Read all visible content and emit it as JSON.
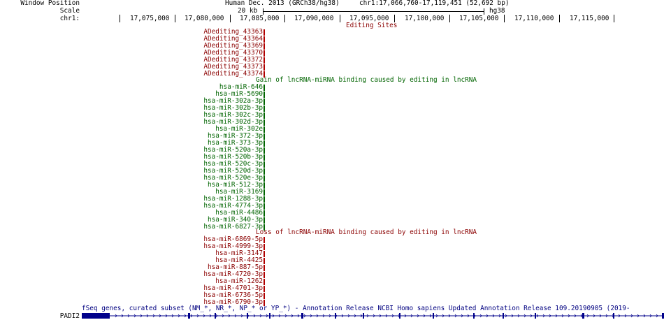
{
  "header": {
    "window_position_label": "Window Position",
    "scale_label": "Scale",
    "chrom_label": "chr1:",
    "assembly": "Human Dec. 2013 (GRCh38/hg38)",
    "position": "chr1:17,066,760-17,119,451 (52,692 bp)",
    "scale_value": "20 kb",
    "scale_assembly": "hg38"
  },
  "ruler": {
    "ticks": [
      "17,075,000",
      "17,080,000",
      "17,085,000",
      "17,090,000",
      "17,095,000",
      "17,100,000",
      "17,105,000",
      "17,110,000",
      "17,115,000"
    ]
  },
  "editing_sites": {
    "title": "Editing Sites",
    "items": [
      "ADediting_43363",
      "ADediting_43364",
      "ADediting_43369",
      "ADediting_43370",
      "ADediting_43372",
      "ADediting_43373",
      "ADediting_43374"
    ]
  },
  "gain_track": {
    "title": "Gain of lncRNA-miRNA binding caused by editing in lncRNA",
    "items": [
      "hsa-miR-646",
      "hsa-miR-5690",
      "hsa-miR-302a-3p",
      "hsa-miR-302b-3p",
      "hsa-miR-302c-3p",
      "hsa-miR-302d-3p",
      "hsa-miR-302e",
      "hsa-miR-372-3p",
      "hsa-miR-373-3p",
      "hsa-miR-520a-3p",
      "hsa-miR-520b-3p",
      "hsa-miR-520c-3p",
      "hsa-miR-520d-3p",
      "hsa-miR-520e-3p",
      "hsa-miR-512-3p",
      "hsa-miR-3169",
      "hsa-miR-1288-3p",
      "hsa-miR-4774-3p",
      "hsa-miR-4486",
      "hsa-miR-340-3p",
      "hsa-miR-6827-3p"
    ]
  },
  "loss_track": {
    "title": "Loss of lncRNA-miRNA binding caused by editing in lncRNA",
    "items": [
      "hsa-miR-6869-5p",
      "hsa-miR-4999-3p",
      "hsa-miR-3147",
      "hsa-miR-4425",
      "hsa-miR-887-5p",
      "hsa-miR-4720-3p",
      "hsa-miR-1262",
      "hsa-miR-4701-3p",
      "hsa-miR-6736-5p",
      "hsa-miR-6790-3p"
    ]
  },
  "gene_track": {
    "title": "fSeq genes, curated subset (NM_*, NR_*, NP_* or YP_*) - Annotation Release NCBI Homo sapiens Updated Annotation Release 109.20190905 (2019-",
    "gene_label": "PADI2"
  },
  "colors": {
    "red": "#8b0000",
    "green": "#006400",
    "gene": "#00008b"
  }
}
